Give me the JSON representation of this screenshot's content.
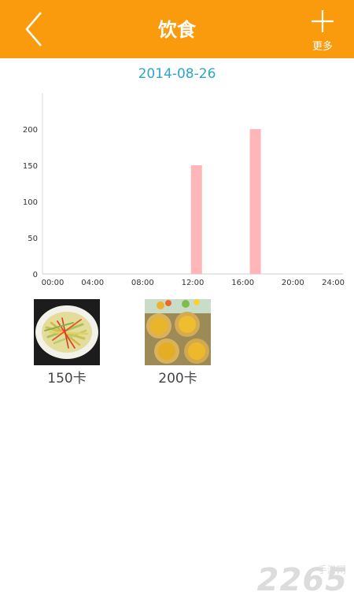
{
  "header": {
    "title": "饮食",
    "more_label": "更多",
    "accent_color": "#f99b0c"
  },
  "date": "2014-08-26",
  "chart_data": {
    "type": "bar",
    "x_ticks": [
      "00:00",
      "04:00",
      "08:00",
      "12:00",
      "16:00",
      "20:00",
      "24:00"
    ],
    "y_ticks": [
      0,
      50,
      100,
      150,
      200
    ],
    "ylim": [
      0,
      250
    ],
    "xlim": [
      0,
      24
    ],
    "series": [
      {
        "x": [
          12.3,
          17.0
        ],
        "values": [
          150,
          200
        ],
        "color": "#ffb6b9"
      }
    ]
  },
  "meals": [
    {
      "calories": "150卡",
      "icon": "shredded-vegetable-dish"
    },
    {
      "calories": "200卡",
      "icon": "egg-tart"
    }
  ],
  "watermark": {
    "brand": "2265",
    "subtitle": "手游网"
  }
}
